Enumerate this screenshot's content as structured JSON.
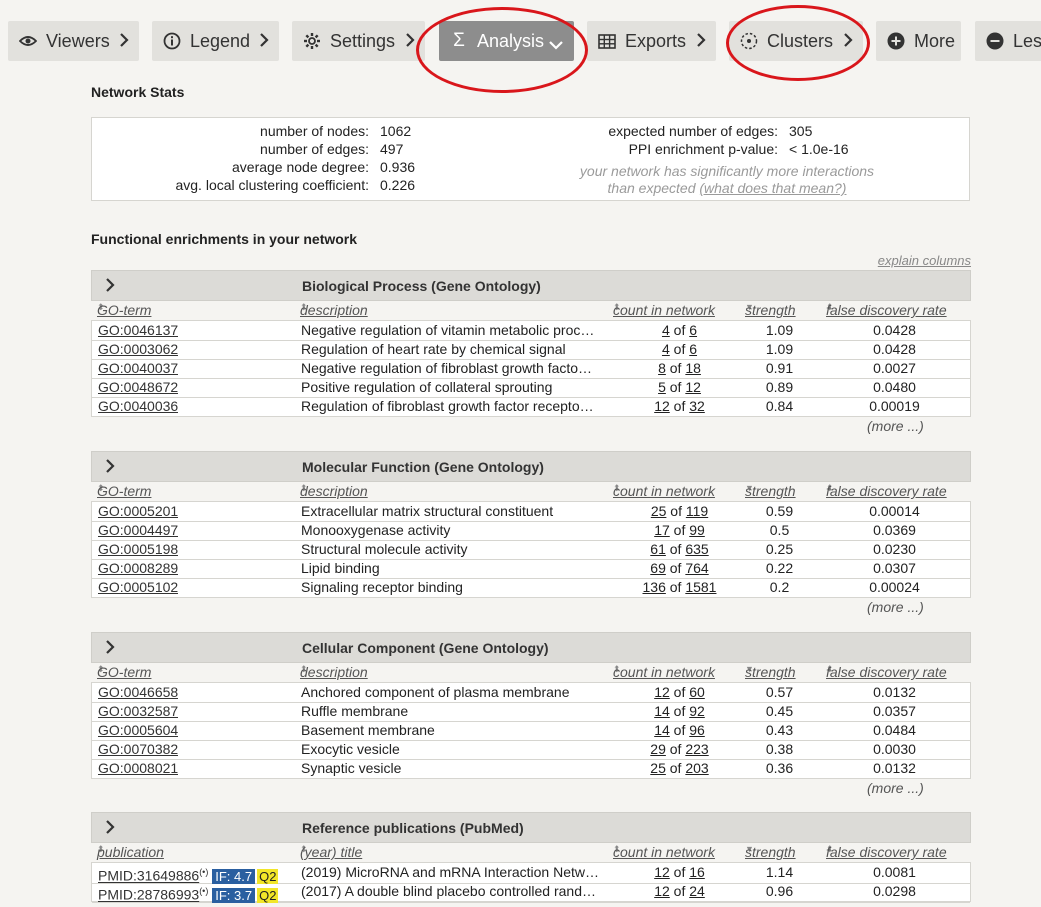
{
  "toolbar": {
    "viewers": "Viewers",
    "legend": "Legend",
    "settings": "Settings",
    "analysis": "Analysis",
    "exports": "Exports",
    "clusters": "Clusters",
    "more": "More",
    "less": "Less"
  },
  "stats": {
    "title": "Network Stats",
    "nodes_label": "number of nodes:",
    "nodes": "1062",
    "edges_label": "number of edges:",
    "edges": "497",
    "degree_label": "average node degree:",
    "degree": "0.936",
    "clust_label": "avg. local clustering coefficient:",
    "clust": "0.226",
    "expected_label": "expected number of edges:",
    "expected": "305",
    "ppi_label": "PPI enrichment p-value:",
    "ppi": "< 1.0e-16",
    "note1": "your network has significantly more interactions",
    "note2": "than expected",
    "note_link": "(what does that mean?)"
  },
  "enrich": {
    "title": "Functional enrichments in your network",
    "explain": "explain columns",
    "more": "(more ...)"
  },
  "tables": {
    "bp": {
      "title": "Biological Process (Gene Ontology)",
      "col1": "GO-term",
      "rows": [
        {
          "term": "GO:0046137",
          "desc": "Negative regulation of vitamin metabolic proc…",
          "count_a": "4",
          "count_b": "6",
          "strength": "1.09",
          "fdr": "0.0428"
        },
        {
          "term": "GO:0003062",
          "desc": "Regulation of heart rate by chemical signal",
          "count_a": "4",
          "count_b": "6",
          "strength": "1.09",
          "fdr": "0.0428"
        },
        {
          "term": "GO:0040037",
          "desc": "Negative regulation of fibroblast growth facto…",
          "count_a": "8",
          "count_b": "18",
          "strength": "0.91",
          "fdr": "0.0027"
        },
        {
          "term": "GO:0048672",
          "desc": "Positive regulation of collateral sprouting",
          "count_a": "5",
          "count_b": "12",
          "strength": "0.89",
          "fdr": "0.0480"
        },
        {
          "term": "GO:0040036",
          "desc": "Regulation of fibroblast growth factor recepto…",
          "count_a": "12",
          "count_b": "32",
          "strength": "0.84",
          "fdr": "0.00019"
        }
      ]
    },
    "mf": {
      "title": "Molecular Function (Gene Ontology)",
      "col1": "GO-term",
      "rows": [
        {
          "term": "GO:0005201",
          "desc": "Extracellular matrix structural constituent",
          "count_a": "25",
          "count_b": "119",
          "strength": "0.59",
          "fdr": "0.00014"
        },
        {
          "term": "GO:0004497",
          "desc": "Monooxygenase activity",
          "count_a": "17",
          "count_b": "99",
          "strength": "0.5",
          "fdr": "0.0369"
        },
        {
          "term": "GO:0005198",
          "desc": "Structural molecule activity",
          "count_a": "61",
          "count_b": "635",
          "strength": "0.25",
          "fdr": "0.0230"
        },
        {
          "term": "GO:0008289",
          "desc": "Lipid binding",
          "count_a": "69",
          "count_b": "764",
          "strength": "0.22",
          "fdr": "0.0307"
        },
        {
          "term": "GO:0005102",
          "desc": "Signaling receptor binding",
          "count_a": "136",
          "count_b": "1581",
          "strength": "0.2",
          "fdr": "0.00024"
        }
      ]
    },
    "cc": {
      "title": "Cellular Component (Gene Ontology)",
      "col1": "GO-term",
      "rows": [
        {
          "term": "GO:0046658",
          "desc": "Anchored component of plasma membrane",
          "count_a": "12",
          "count_b": "60",
          "strength": "0.57",
          "fdr": "0.0132"
        },
        {
          "term": "GO:0032587",
          "desc": "Ruffle membrane",
          "count_a": "14",
          "count_b": "92",
          "strength": "0.45",
          "fdr": "0.0357"
        },
        {
          "term": "GO:0005604",
          "desc": "Basement membrane",
          "count_a": "14",
          "count_b": "96",
          "strength": "0.43",
          "fdr": "0.0484"
        },
        {
          "term": "GO:0070382",
          "desc": "Exocytic vesicle",
          "count_a": "29",
          "count_b": "223",
          "strength": "0.38",
          "fdr": "0.0030"
        },
        {
          "term": "GO:0008021",
          "desc": "Synaptic vesicle",
          "count_a": "25",
          "count_b": "203",
          "strength": "0.36",
          "fdr": "0.0132"
        }
      ]
    },
    "pm": {
      "title": "Reference publications (PubMed)",
      "col1": "publication",
      "col2": "(year) title",
      "rows": [
        {
          "term": "PMID:31649886",
          "if": "IF: 4.7",
          "q": "Q2",
          "desc": "(2019) MicroRNA and mRNA Interaction Netw…",
          "count_a": "12",
          "count_b": "16",
          "strength": "1.14",
          "fdr": "0.0081"
        },
        {
          "term": "PMID:28786993",
          "if": "IF: 3.7",
          "q": "Q2",
          "desc": "(2017) A double blind placebo controlled rand…",
          "count_a": "12",
          "count_b": "24",
          "strength": "0.96",
          "fdr": "0.0298"
        }
      ]
    },
    "cols": {
      "description": "description",
      "count": "count in network",
      "strength": "strength",
      "fdr": "false discovery rate",
      "of": "of"
    }
  }
}
